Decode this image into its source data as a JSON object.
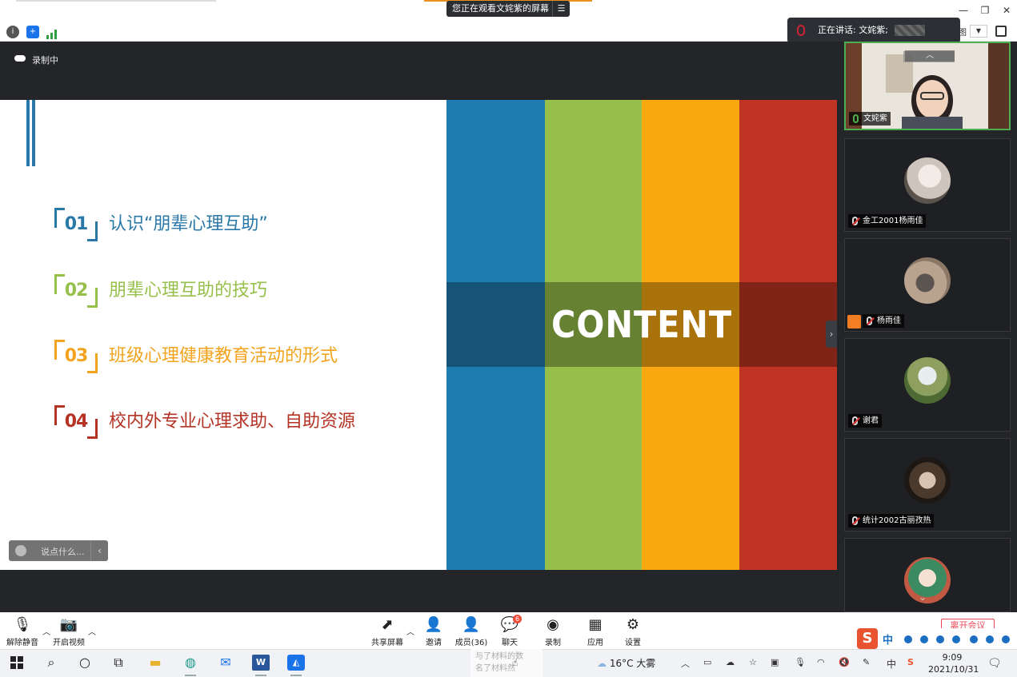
{
  "titlebar": {
    "share_notice": "您正在观看文姹紫的屏幕",
    "share_menu_icon": "menu-icon",
    "controls": [
      "minimize",
      "restore",
      "close"
    ]
  },
  "speaking_banner": {
    "label": "正在讲话: 文姹紫;",
    "view_tail": "图"
  },
  "recording": {
    "label": "录制中"
  },
  "slide": {
    "items": [
      {
        "num": "01",
        "text": "认识“朋辈心理互助”",
        "color": "#2a78a8"
      },
      {
        "num": "02",
        "text": "朋辈心理互助的技巧",
        "color": "#97bf4b"
      },
      {
        "num": "03",
        "text": "班级心理健康教育活动的形式",
        "color": "#f2a41f"
      },
      {
        "num": "04",
        "text": "校内外专业心理求助、自助资源",
        "color": "#b53324"
      }
    ],
    "banner_word": "CONTENT",
    "stripe_colors": [
      "#1f7cb0",
      "#97bf4b",
      "#f9a90f",
      "#c03423"
    ]
  },
  "chat": {
    "placeholder": "说点什么..."
  },
  "participants": [
    {
      "name": "文姹紫"
    },
    {
      "name": "金工2001杨雨佳"
    },
    {
      "name": "杨雨佳"
    },
    {
      "name": "谢君"
    },
    {
      "name": "统计2002古丽孜热"
    },
    {
      "name": ""
    }
  ],
  "toolbar": {
    "unmute": "解除静音",
    "start_video": "开启视频",
    "share": "共享屏幕",
    "invite": "邀请",
    "members": "成员(36)",
    "chat": "聊天",
    "chat_badge": "6",
    "record": "录制",
    "apps": "应用",
    "settings": "设置",
    "leave": "离开会议"
  },
  "ime": {
    "logo": "S",
    "mode": "中"
  },
  "taskbar": {
    "ghost_lines": [
      "与了材料的数",
      "名了材料然"
    ],
    "weather": "16°C 大雾",
    "ime_indicator": "中",
    "time": "9:09",
    "date": "2021/10/31"
  }
}
